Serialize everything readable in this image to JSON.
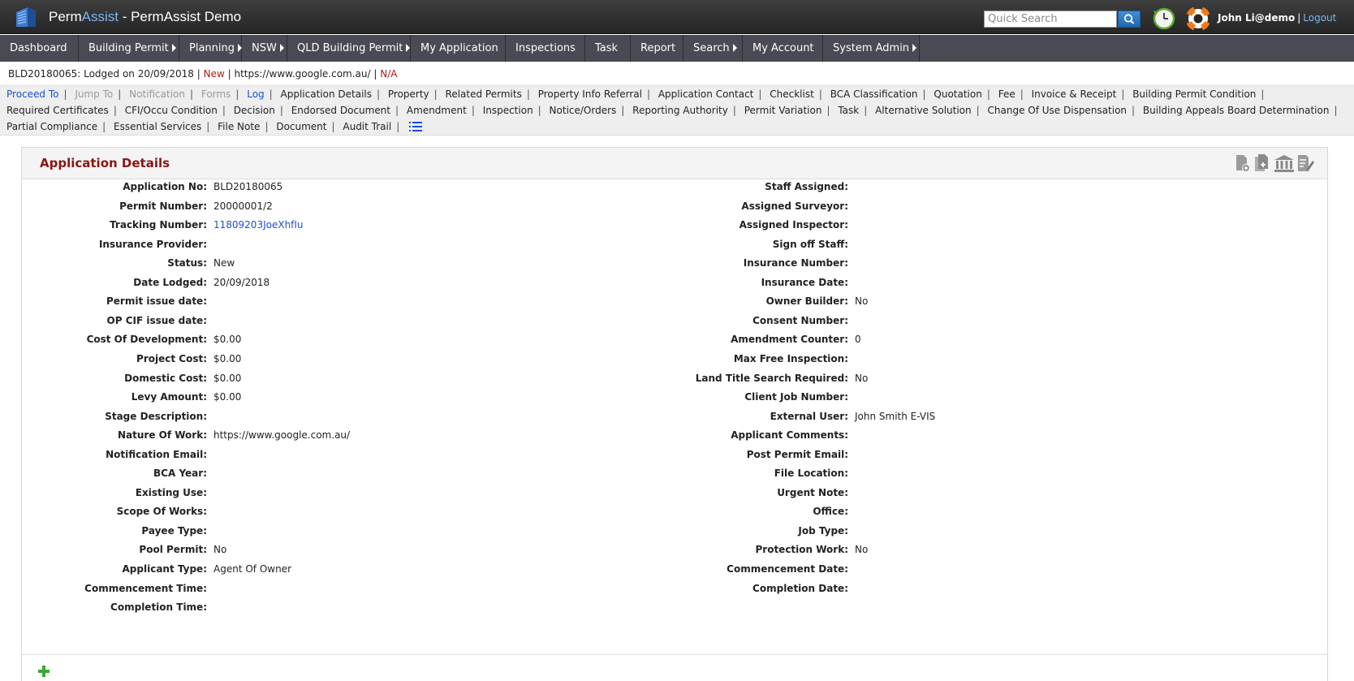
{
  "header": {
    "brand_part1": "Perm",
    "brand_part2": "Assist",
    "title_rest": " - PermAssist Demo",
    "search_placeholder": "Quick Search",
    "user": "John Li@demo",
    "separator": "|",
    "logout": "Logout",
    "accent_color": "#7ab6f2"
  },
  "menu": [
    {
      "label": "Dashboard",
      "caret": false,
      "width": 97
    },
    {
      "label": "Building Permit",
      "caret": true,
      "width": 124
    },
    {
      "label": "Planning",
      "caret": true,
      "width": 77
    },
    {
      "label": "NSW",
      "caret": true,
      "width": 56
    },
    {
      "label": "QLD Building Permit",
      "caret": true,
      "width": 152
    },
    {
      "label": "My Application",
      "caret": false,
      "width": 117
    },
    {
      "label": "Inspections",
      "caret": false,
      "width": 98
    },
    {
      "label": "Task",
      "caret": false,
      "width": 56
    },
    {
      "label": "Report",
      "caret": false,
      "width": 65
    },
    {
      "label": "Search",
      "caret": true,
      "width": 73
    },
    {
      "label": "My Account",
      "caret": false,
      "width": 99
    },
    {
      "label": "System Admin",
      "caret": true,
      "width": 119
    }
  ],
  "context": {
    "app_ref": "BLD20180065: Lodged on 20/09/2018",
    "status": "New",
    "nature": "https://www.google.com.au/",
    "extra": "N/A",
    "sep": "|"
  },
  "links": [
    {
      "label": "Proceed To",
      "style": "blue"
    },
    {
      "label": "Jump To",
      "style": "gray"
    },
    {
      "label": "Notification",
      "style": "gray"
    },
    {
      "label": "Forms",
      "style": "gray"
    },
    {
      "label": "Log",
      "style": "blue"
    },
    {
      "label": "Application Details",
      "style": "normal"
    },
    {
      "label": "Property",
      "style": "normal"
    },
    {
      "label": "Related Permits",
      "style": "normal"
    },
    {
      "label": "Property Info Referral",
      "style": "normal"
    },
    {
      "label": "Application Contact",
      "style": "normal"
    },
    {
      "label": "Checklist",
      "style": "normal"
    },
    {
      "label": "BCA Classification",
      "style": "normal"
    },
    {
      "label": "Quotation",
      "style": "normal"
    },
    {
      "label": "Fee",
      "style": "normal"
    },
    {
      "label": "Invoice & Receipt",
      "style": "normal"
    },
    {
      "label": "Building Permit Condition",
      "style": "normal"
    },
    {
      "label": "Required Certificates",
      "style": "normal"
    },
    {
      "label": "CFI/Occu Condition",
      "style": "normal"
    },
    {
      "label": "Decision",
      "style": "normal"
    },
    {
      "label": "Endorsed Document",
      "style": "normal"
    },
    {
      "label": "Amendment",
      "style": "normal"
    },
    {
      "label": "Inspection",
      "style": "normal"
    },
    {
      "label": "Notice/Orders",
      "style": "normal"
    },
    {
      "label": "Reporting Authority",
      "style": "normal"
    },
    {
      "label": "Permit Variation",
      "style": "normal"
    },
    {
      "label": "Task",
      "style": "normal"
    },
    {
      "label": "Alternative Solution",
      "style": "normal"
    },
    {
      "label": "Change Of Use Dispensation",
      "style": "normal"
    },
    {
      "label": "Building Appeals Board Determination",
      "style": "normal"
    },
    {
      "label": "Partial Compliance",
      "style": "normal"
    },
    {
      "label": "Essential Services",
      "style": "normal"
    },
    {
      "label": "File Note",
      "style": "normal"
    },
    {
      "label": "Document",
      "style": "normal"
    },
    {
      "label": "Audit Trail",
      "style": "normal"
    }
  ],
  "panel": {
    "title": "Application Details",
    "title_color": "#8a1515"
  },
  "left_fields": [
    {
      "label": "Application No:",
      "value": "BLD20180065"
    },
    {
      "label": "Permit Number:",
      "value": "20000001/2"
    },
    {
      "label": "Tracking Number:",
      "value": "11809203JoeXhfIu",
      "link": true
    },
    {
      "label": "Insurance Provider:",
      "value": ""
    },
    {
      "label": "Status:",
      "value": "New"
    },
    {
      "label": "Date Lodged:",
      "value": "20/09/2018"
    },
    {
      "label": "Permit issue date:",
      "value": ""
    },
    {
      "label": "OP CIF issue date:",
      "value": ""
    },
    {
      "label": "Cost Of Development:",
      "value": "$0.00"
    },
    {
      "label": "Project Cost:",
      "value": "$0.00"
    },
    {
      "label": "Domestic Cost:",
      "value": "$0.00"
    },
    {
      "label": "Levy Amount:",
      "value": "$0.00"
    },
    {
      "label": "Stage Description:",
      "value": ""
    },
    {
      "label": "Nature Of Work:",
      "value": "https://www.google.com.au/"
    },
    {
      "label": "Notification Email:",
      "value": ""
    },
    {
      "label": "BCA Year:",
      "value": ""
    },
    {
      "label": "Existing Use:",
      "value": ""
    },
    {
      "label": "Scope Of Works:",
      "value": ""
    },
    {
      "label": "Payee Type:",
      "value": ""
    },
    {
      "label": "Pool Permit:",
      "value": "No"
    },
    {
      "label": "Applicant Type:",
      "value": "Agent Of Owner"
    },
    {
      "label": "Commencement Time:",
      "value": ""
    },
    {
      "label": "Completion Time:",
      "value": ""
    }
  ],
  "right_fields": [
    {
      "label": "Staff Assigned:",
      "value": ""
    },
    {
      "label": "Assigned Surveyor:",
      "value": ""
    },
    {
      "label": "Assigned Inspector:",
      "value": ""
    },
    {
      "label": "Sign off Staff:",
      "value": ""
    },
    {
      "label": "Insurance Number:",
      "value": ""
    },
    {
      "label": "Insurance Date:",
      "value": ""
    },
    {
      "label": "Owner Builder:",
      "value": "No"
    },
    {
      "label": "Consent Number:",
      "value": ""
    },
    {
      "label": "Amendment Counter:",
      "value": "0"
    },
    {
      "label": "Max Free Inspection:",
      "value": ""
    },
    {
      "label": "Land Title Search Required:",
      "value": "No"
    },
    {
      "label": "Client Job Number:",
      "value": ""
    },
    {
      "label": "External User:",
      "value": "John Smith E-VIS"
    },
    {
      "label": "Applicant Comments:",
      "value": ""
    },
    {
      "label": "Post Permit Email:",
      "value": ""
    },
    {
      "label": "File Location:",
      "value": ""
    },
    {
      "label": "Urgent Note:",
      "value": ""
    },
    {
      "label": "Office:",
      "value": ""
    },
    {
      "label": "Job Type:",
      "value": ""
    },
    {
      "label": "Protection Work:",
      "value": "No"
    },
    {
      "label": "Commencement Date:",
      "value": ""
    },
    {
      "label": "Completion Date:",
      "value": ""
    }
  ]
}
